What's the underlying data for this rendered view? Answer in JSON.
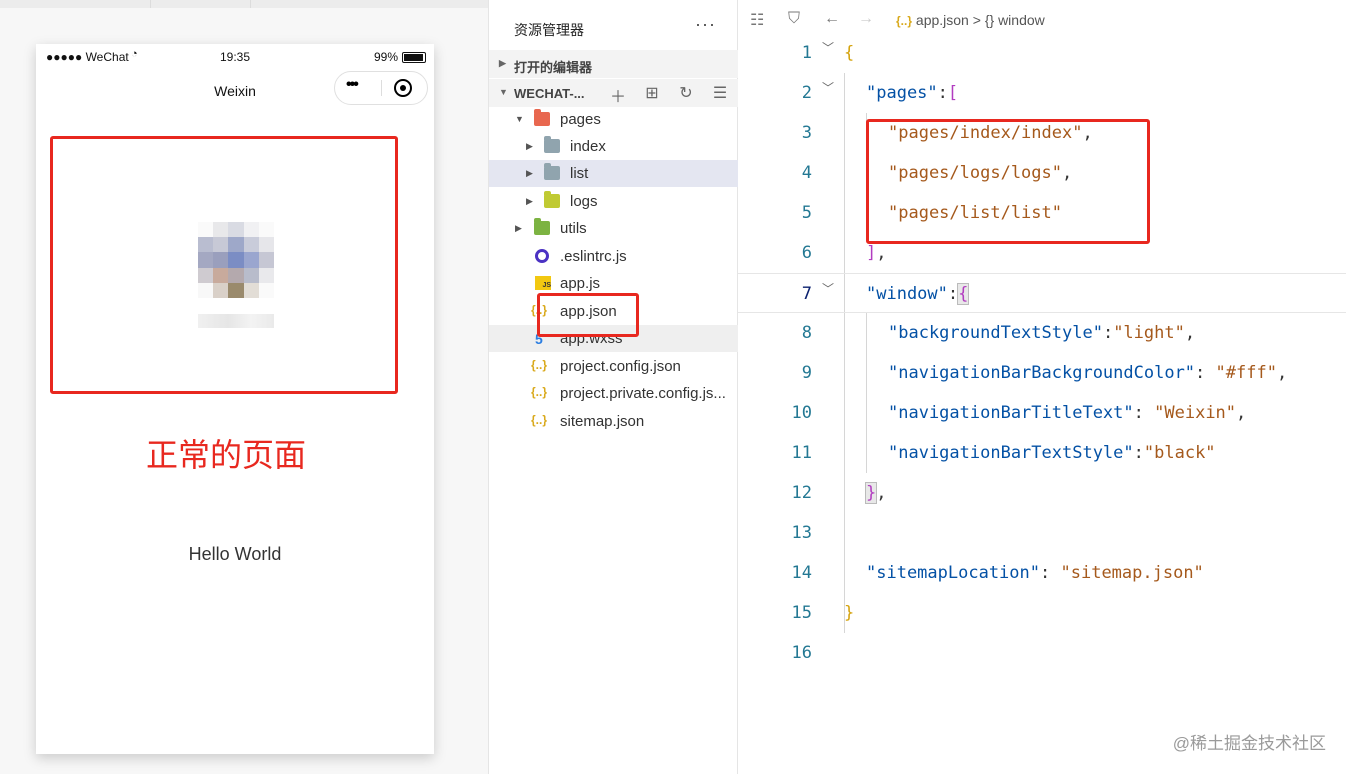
{
  "simulator": {
    "status_left": "●●●●● WeChat",
    "wifi_icon": "wifi-icon",
    "time": "19:35",
    "battery": "99%",
    "nav_title": "Weixin",
    "capsule_more": "•••",
    "annotation": "正常的页面",
    "hello": "Hello World"
  },
  "explorer": {
    "title": "资源管理器",
    "more": "···",
    "open_editors": "打开的编辑器",
    "project": "WECHAT-...",
    "tree": [
      {
        "label": "pages",
        "type": "folder-open",
        "color": "#e8674f"
      },
      {
        "label": "index",
        "type": "folder",
        "color": "#90a4ae"
      },
      {
        "label": "list",
        "type": "folder",
        "color": "#90a4ae"
      },
      {
        "label": "logs",
        "type": "folder",
        "color": "#c0ca33"
      },
      {
        "label": "utils",
        "type": "folder",
        "color": "#7cb342"
      },
      {
        "label": ".eslintrc.js",
        "type": "eslint"
      },
      {
        "label": "app.js",
        "type": "js"
      },
      {
        "label": "app.json",
        "type": "json"
      },
      {
        "label": "app.wxss",
        "type": "css"
      },
      {
        "label": "project.config.json",
        "type": "json"
      },
      {
        "label": "project.private.config.js...",
        "type": "json"
      },
      {
        "label": "sitemap.json",
        "type": "json"
      }
    ]
  },
  "editor": {
    "breadcrumb_icon": "{..}",
    "breadcrumb_file": "app.json",
    "breadcrumb_sep": ">",
    "breadcrumb_sym": "{}",
    "breadcrumb_node": "window",
    "line_numbers": [
      "1",
      "2",
      "3",
      "4",
      "5",
      "6",
      "7",
      "8",
      "9",
      "10",
      "11",
      "12",
      "13",
      "14",
      "15",
      "16"
    ],
    "code": {
      "l1_brace": "{",
      "l2_key": "\"pages\"",
      "l2_colon": ":",
      "l2_bracket": "[",
      "l3_val": "\"pages/index/index\"",
      "l4_val": "\"pages/logs/logs\"",
      "l5_val": "\"pages/list/list\"",
      "comma": ",",
      "l6_bracket": "]",
      "l7_key": "\"window\"",
      "l7_brace": "{",
      "l8_key": "\"backgroundTextStyle\"",
      "l8_val": "\"light\"",
      "l9_key": "\"navigationBarBackgroundColor\"",
      "l9_val": "\"#fff\"",
      "l10_key": "\"navigationBarTitleText\"",
      "l10_val": "\"Weixin\"",
      "l11_key": "\"navigationBarTextStyle\"",
      "l11_val": "\"black\"",
      "l12_brace": "}",
      "l14_key": "\"sitemapLocation\"",
      "l14_val": "\"sitemap.json\"",
      "l15_brace": "}"
    }
  },
  "watermark": "@稀土掘金技术社区"
}
